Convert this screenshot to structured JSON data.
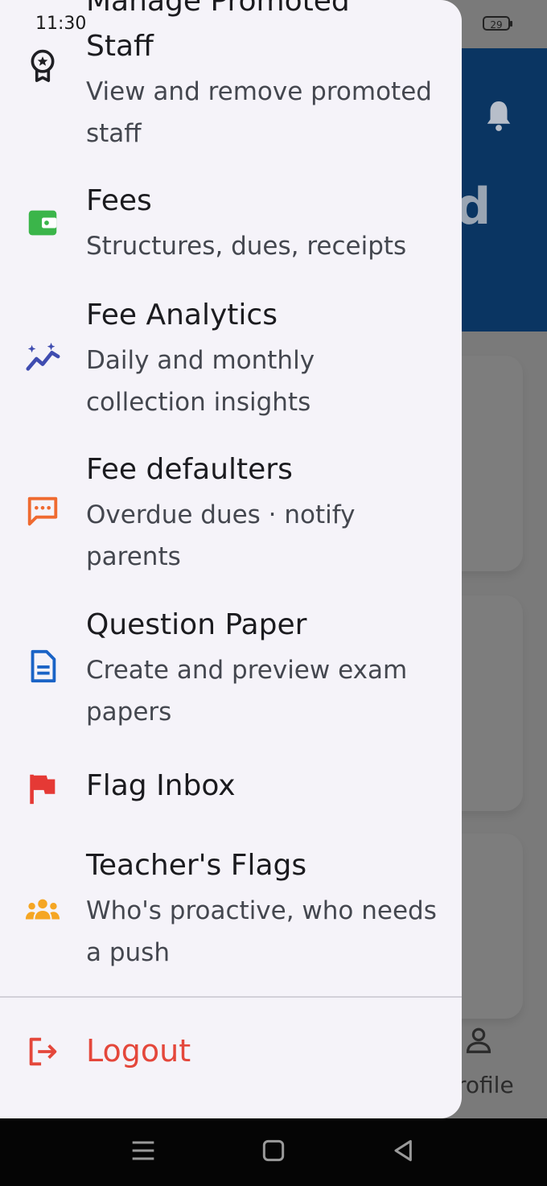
{
  "status_bar": {
    "time": "11:30",
    "battery": "29"
  },
  "background": {
    "hero_letter": "d",
    "profile_label": "rofile"
  },
  "drawer": {
    "clipped_title": "Manage Promoted",
    "items": [
      {
        "icon": "award-badge-icon",
        "title": "Staff",
        "subtitle": "View and remove promoted staff"
      },
      {
        "icon": "wallet-icon",
        "title": "Fees",
        "subtitle": "Structures, dues, receipts"
      },
      {
        "icon": "analytics-sparkle-icon",
        "title": "Fee Analytics",
        "subtitle": "Daily and monthly collection insights"
      },
      {
        "icon": "message-dots-icon",
        "title": "Fee defaulters",
        "subtitle": "Overdue dues · notify parents"
      },
      {
        "icon": "document-icon",
        "title": "Question Paper",
        "subtitle": "Create and preview exam papers"
      },
      {
        "icon": "flag-icon",
        "title": "Flag Inbox",
        "subtitle": ""
      },
      {
        "icon": "groups-icon",
        "title": "Teacher's Flags",
        "subtitle": "Who's proactive, who needs a push"
      }
    ],
    "logout_label": "Logout"
  },
  "colors": {
    "header": "#0a3562",
    "drawer_bg": "#f5f3f9",
    "logout": "#e4473b",
    "fees_icon": "#3bb54a",
    "analytics_icon": "#3f4cb0",
    "defaulters_icon": "#ef6a30",
    "question_icon": "#1a63c6",
    "flag_icon": "#e53935",
    "teachers_icon": "#f5a623"
  }
}
